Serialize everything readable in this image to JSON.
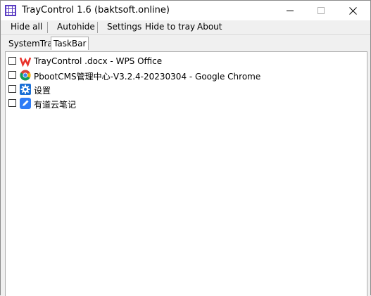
{
  "window": {
    "title": "TrayControl 1.6 (baktsoft.online)",
    "minimize_icon": "minimize-icon",
    "maximize_icon": "maximize-icon",
    "close_icon": "close-icon"
  },
  "menu": {
    "hide_all": "Hide all",
    "autohide": "Autohide",
    "settings": "Settings",
    "hide_to_tray": "Hide to tray",
    "about": "About"
  },
  "tabs": [
    {
      "label": "SystemTray",
      "active": false
    },
    {
      "label": "TaskBar",
      "active": true
    }
  ],
  "items": [
    {
      "label": "TrayControl .docx - WPS Office",
      "icon": "wps-office-icon",
      "checked": false
    },
    {
      "label": "PbootCMS管理中心-V3.2.4-20230304 - Google Chrome",
      "icon": "chrome-icon",
      "checked": false
    },
    {
      "label": "设置",
      "icon": "settings-gear-icon",
      "checked": false
    },
    {
      "label": "有道云笔记",
      "icon": "youdao-note-icon",
      "checked": false
    }
  ],
  "colors": {
    "app_icon": "#5a3cc2",
    "wps_red": "#e8312a",
    "settings_blue": "#1a6fd6",
    "youdao_blue": "#2f7cf6"
  }
}
